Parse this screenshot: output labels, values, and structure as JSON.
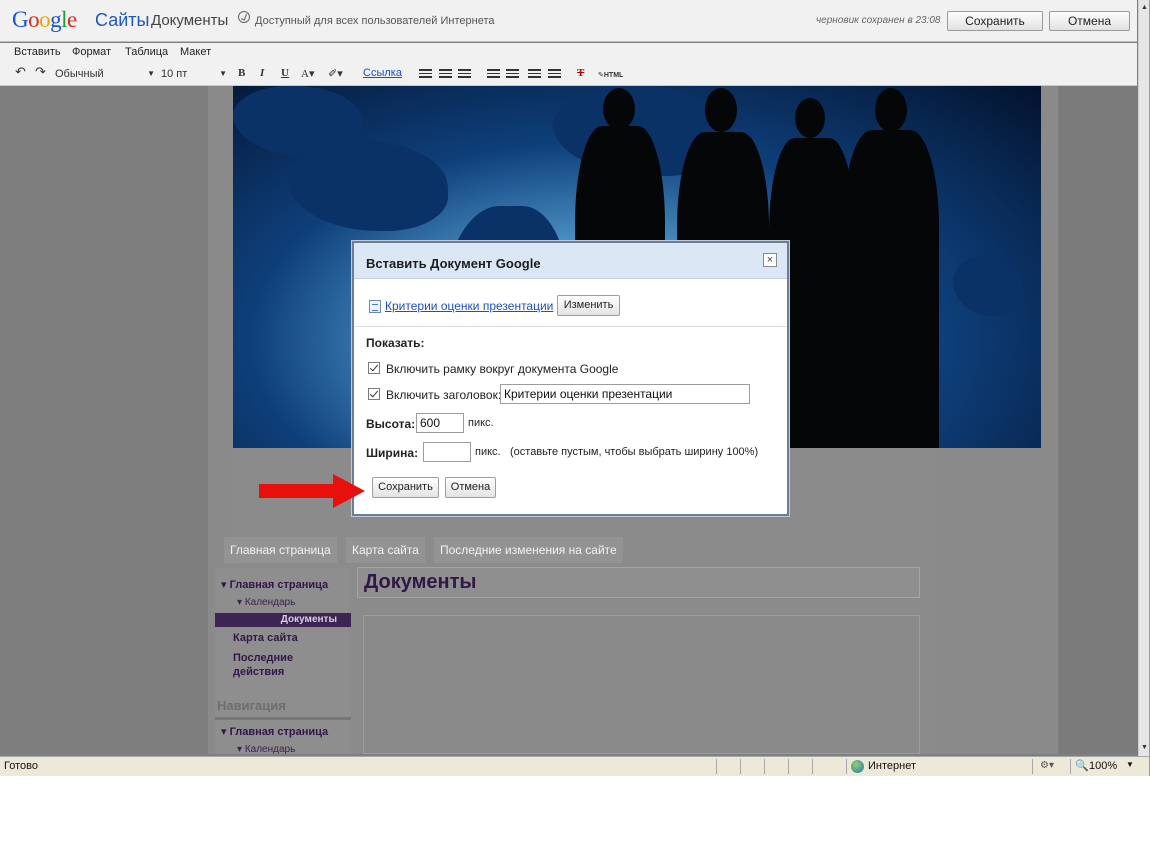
{
  "header": {
    "logo": "Google",
    "product": "Сайты",
    "page_name": "Документы",
    "access": "Доступный для всех пользователей Интернета",
    "draft_status": "черновик сохранен в 23:08",
    "save_label": "Сохранить",
    "cancel_label": "Отмена"
  },
  "menu": {
    "items": [
      "Вставить",
      "Формат",
      "Таблица",
      "Макет"
    ]
  },
  "toolbar": {
    "style_select": "Обычный",
    "size_select": "10 пт",
    "bold": "B",
    "italic": "I",
    "underline": "U",
    "font_color": "A",
    "link": "Ссылка",
    "clear_format": "T",
    "html": "HTML"
  },
  "tabs": [
    "Главная страница",
    "Карта сайта",
    "Последние изменения на сайте"
  ],
  "sidebar": {
    "home": "Главная страница",
    "calendar": "Календарь",
    "documents": "Документы",
    "sitemap": "Карта сайта",
    "recent": "Последние действия",
    "nav_heading": "Навигация",
    "nav_home": "Главная страница",
    "nav_calendar": "Календарь"
  },
  "content": {
    "title": "Документы"
  },
  "dialog": {
    "title": "Вставить Документ Google",
    "close": "×",
    "doc_link": "Критерии оценки презентации",
    "change_label": "Изменить",
    "show_label": "Показать:",
    "border_option": "Включить рамку вокруг документа Google",
    "border_checked": true,
    "title_option": "Включить заголовок:",
    "title_checked": true,
    "title_value": "Критерии оценки презентации",
    "height_label": "Высота:",
    "height_value": "600",
    "height_unit": "пикс.",
    "width_label": "Ширина:",
    "width_value": "",
    "width_unit": "пикс.",
    "width_hint": "(оставьте пустым, чтобы выбрать ширину 100%)",
    "save_label": "Сохранить",
    "cancel_label": "Отмена"
  },
  "statusbar": {
    "ready": "Готово",
    "zone": "Интернет",
    "zoom": "100%"
  },
  "colors": {
    "overlay_gray": "#7f7f7f",
    "dialog_header": "#dbe7f5",
    "link_blue": "#1c4fc2",
    "arrow_red": "#e8100c",
    "sidebar_purple": "#3d2553"
  }
}
